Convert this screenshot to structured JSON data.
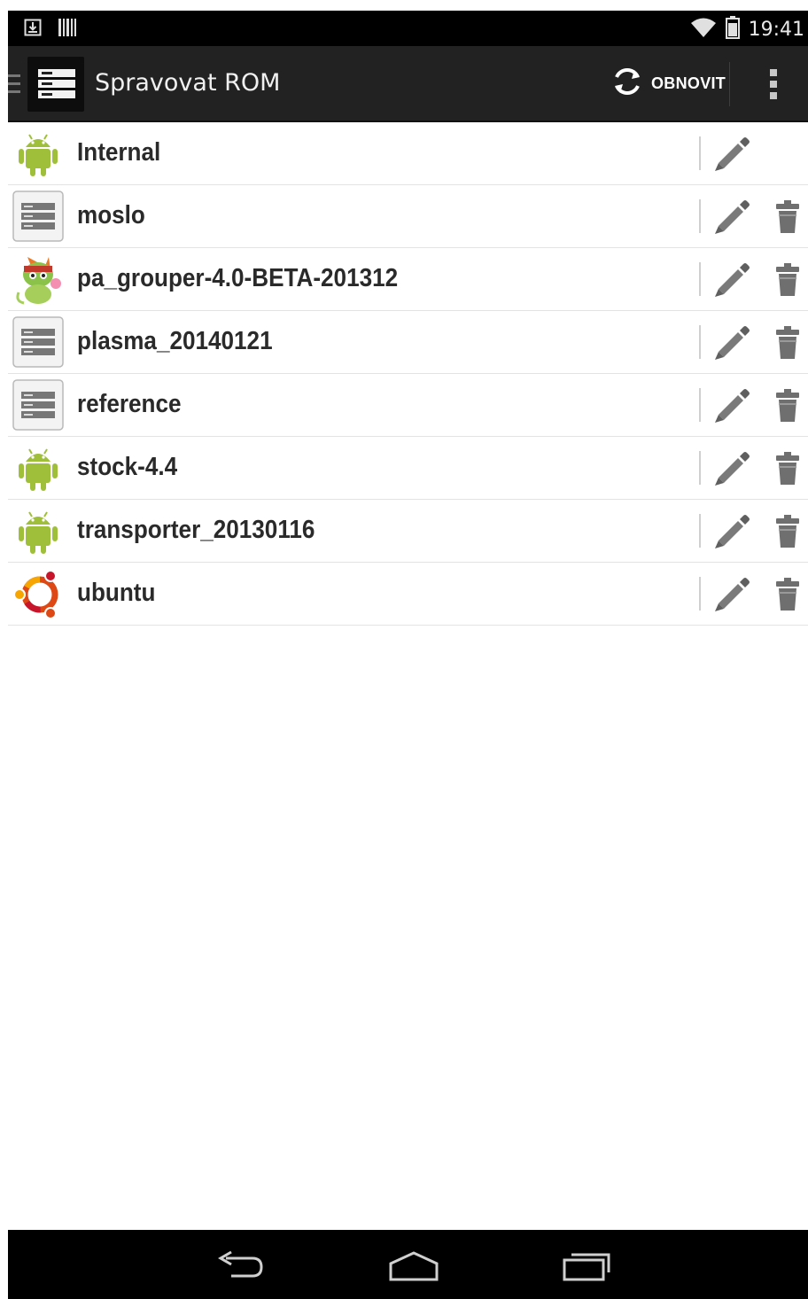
{
  "status_bar": {
    "time": "19:41",
    "left_icons": [
      "download-icon",
      "barcode-icon"
    ],
    "right_icons": [
      "wifi-icon",
      "battery-icon"
    ]
  },
  "action_bar": {
    "title": "Spravovat ROM",
    "refresh_label": "OBNOVIT",
    "icons": [
      "drawer-icon",
      "rom-manager-app-icon",
      "refresh-icon",
      "overflow-menu-icon"
    ]
  },
  "roms": [
    {
      "name": "Internal",
      "icon": "android-icon",
      "deletable": false
    },
    {
      "name": "moslo",
      "icon": "generic-rom-icon",
      "deletable": true
    },
    {
      "name": "pa_grouper-4.0-BETA-201312",
      "icon": "paranoid-android-icon",
      "deletable": true
    },
    {
      "name": "plasma_20140121",
      "icon": "generic-rom-icon",
      "deletable": true
    },
    {
      "name": "reference",
      "icon": "generic-rom-icon",
      "deletable": true
    },
    {
      "name": "stock-4.4",
      "icon": "android-icon",
      "deletable": true
    },
    {
      "name": "transporter_20130116",
      "icon": "android-icon",
      "deletable": true
    },
    {
      "name": "ubuntu",
      "icon": "ubuntu-icon",
      "deletable": true
    }
  ],
  "nav_bar": {
    "buttons": [
      "back-icon",
      "home-icon",
      "recents-icon"
    ]
  },
  "colors": {
    "status_bar": "#000000",
    "action_bar": "#222222",
    "android_green": "#9fbf3b",
    "ubuntu_orange": "#dd4814",
    "ubuntu_red": "#c7162b",
    "ubuntu_yellow": "#f7a600"
  }
}
